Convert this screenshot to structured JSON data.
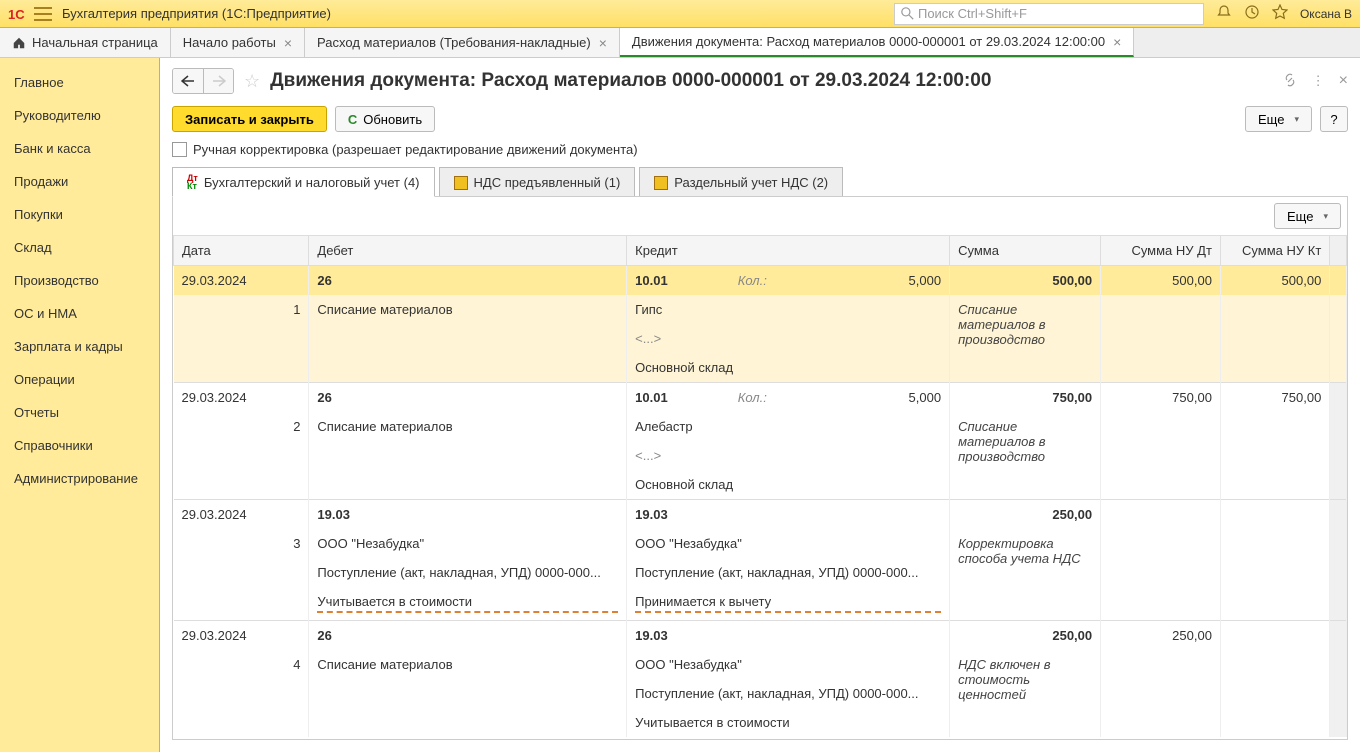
{
  "titlebar": {
    "app_title": "Бухгалтерия предприятия  (1С:Предприятие)",
    "search_placeholder": "Поиск Ctrl+Shift+F",
    "user": "Оксана В"
  },
  "tabs": {
    "home": "Начальная страница",
    "items": [
      {
        "label": "Начало работы"
      },
      {
        "label": "Расход материалов (Требования-накладные)"
      },
      {
        "label": "Движения документа: Расход материалов 0000-000001 от 29.03.2024 12:00:00"
      }
    ]
  },
  "sidebar": {
    "items": [
      "Главное",
      "Руководителю",
      "Банк и касса",
      "Продажи",
      "Покупки",
      "Склад",
      "Производство",
      "ОС и НМА",
      "Зарплата и кадры",
      "Операции",
      "Отчеты",
      "Справочники",
      "Администрирование"
    ]
  },
  "page": {
    "title": "Движения документа: Расход материалов 0000-000001 от 29.03.2024 12:00:00",
    "save_close": "Записать и закрыть",
    "refresh": "Обновить",
    "more": "Еще",
    "help": "?",
    "manual_edit": "Ручная корректировка (разрешает редактирование движений документа)"
  },
  "doc_tabs": [
    {
      "label": "Бухгалтерский и налоговый учет (4)"
    },
    {
      "label": "НДС предъявленный (1)"
    },
    {
      "label": "Раздельный учет НДС (2)"
    }
  ],
  "table": {
    "more": "Еще",
    "headers": {
      "date": "Дата",
      "debit": "Дебет",
      "credit": "Кредит",
      "sum": "Сумма",
      "nudt": "Сумма НУ Дт",
      "nukt": "Сумма НУ Кт"
    },
    "kol_label": "Кол.:",
    "placeholder_brackets": "<...>",
    "rows": [
      {
        "n": "1",
        "date": "29.03.2024",
        "debit_acc": "26",
        "credit_acc": "10.01",
        "qty": "5,000",
        "sum": "500,00",
        "nudt": "500,00",
        "nukt": "500,00",
        "debit_sub": "Списание материалов",
        "credit_sub1": "Гипс",
        "credit_sub2_placeholder": true,
        "credit_sub3": "Основной склад",
        "sum_desc": "Списание материалов в производство",
        "highlight": true
      },
      {
        "n": "2",
        "date": "29.03.2024",
        "debit_acc": "26",
        "credit_acc": "10.01",
        "qty": "5,000",
        "sum": "750,00",
        "nudt": "750,00",
        "nukt": "750,00",
        "debit_sub": "Списание материалов",
        "credit_sub1": "Алебастр",
        "credit_sub2_placeholder": true,
        "credit_sub3": "Основной склад",
        "sum_desc": "Списание материалов в производство"
      },
      {
        "n": "3",
        "date": "29.03.2024",
        "debit_acc": "19.03",
        "credit_acc": "19.03",
        "qty": "",
        "sum": "250,00",
        "nudt": "",
        "nukt": "",
        "debit_sub": "ООО \"Незабудка\"",
        "debit_sub2": "Поступление (акт, накладная, УПД) 0000-000...",
        "debit_sub3": "Учитывается в стоимости",
        "credit_sub1": "ООО \"Незабудка\"",
        "credit_sub2": "Поступление (акт, накладная, УПД) 0000-000...",
        "credit_sub3": "Принимается к вычету",
        "sum_desc": "Корректировка способа учета НДС",
        "orange_line": true
      },
      {
        "n": "4",
        "date": "29.03.2024",
        "debit_acc": "26",
        "credit_acc": "19.03",
        "qty": "",
        "sum": "250,00",
        "nudt": "250,00",
        "nukt": "",
        "debit_sub": "Списание материалов",
        "credit_sub1": "ООО \"Незабудка\"",
        "credit_sub2": "Поступление (акт, накладная, УПД) 0000-000...",
        "credit_sub3": "Учитывается в стоимости",
        "sum_desc": "НДС включен в стоимость ценностей"
      }
    ]
  }
}
